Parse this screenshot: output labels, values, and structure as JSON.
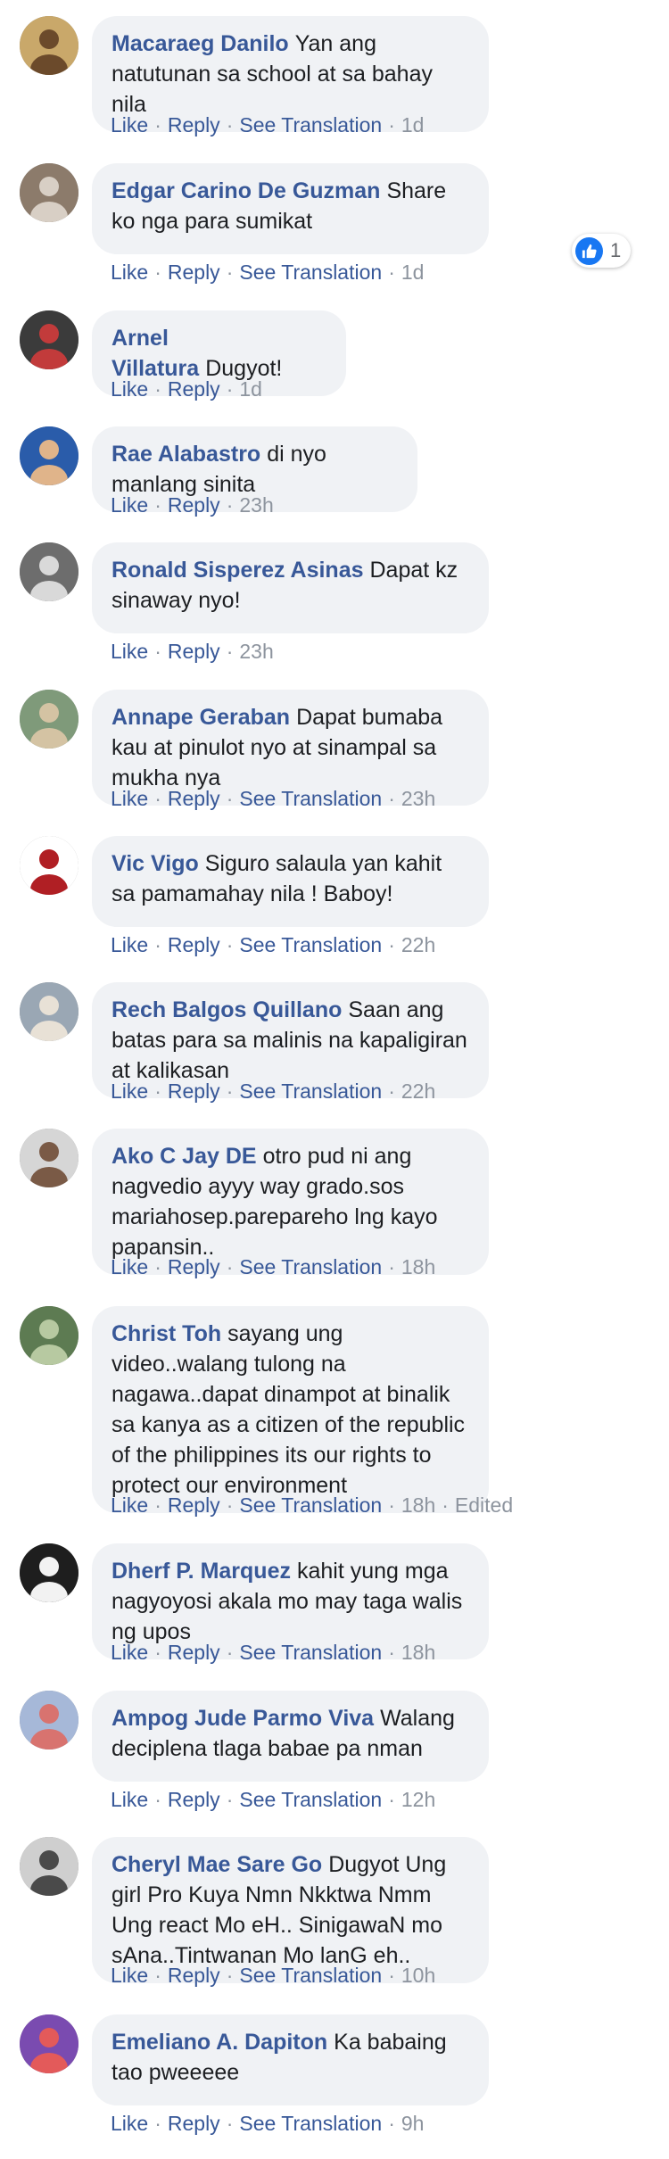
{
  "actions": {
    "like": "Like",
    "reply": "Reply",
    "see_translation": "See Translation",
    "separator": "·",
    "edited": "Edited"
  },
  "colors": {
    "author": "#385898",
    "bubble": "#f0f2f5",
    "meta": "#8d949e",
    "like_blue": "#1877f2"
  },
  "comments": [
    {
      "author": "Macaraeg Danilo",
      "text": "Yan ang natutunan sa school at sa bahay nila",
      "translation": true,
      "time": "1d"
    },
    {
      "author": "Edgar Carino De Guzman",
      "text": "Share ko nga para sumikat",
      "translation": true,
      "time": "1d",
      "reactions": {
        "icon": "thumbs-up-icon",
        "count": "1"
      }
    },
    {
      "author": "Arnel Villatura",
      "text": "Dugyot!",
      "translation": false,
      "time": "1d"
    },
    {
      "author": "Rae Alabastro",
      "text": "di nyo manlang sinita",
      "translation": false,
      "time": "23h"
    },
    {
      "author": "Ronald Sisperez Asinas",
      "text": "Dapat kz sinaway nyo!",
      "translation": false,
      "time": "23h"
    },
    {
      "author": "Annape Geraban",
      "text": "Dapat bumaba kau at pinulot nyo at sinampal sa mukha nya",
      "translation": true,
      "time": "23h"
    },
    {
      "author": "Vic Vigo",
      "text": "Siguro salaula yan kahit sa pamamahay nila ! Baboy!",
      "translation": true,
      "time": "22h"
    },
    {
      "author": "Rech Balgos Quillano",
      "text": "Saan ang batas para sa malinis na kapaligiran at kalikasan",
      "translation": true,
      "time": "22h"
    },
    {
      "author": "Ako C Jay DE",
      "text": "otro pud ni ang nagvedio ayyy way grado.sos mariahosep.parepareho lng kayo papansin..",
      "translation": true,
      "time": "18h"
    },
    {
      "author": "Christ Toh",
      "text": "sayang ung video..walang tulong na nagawa..dapat dinampot at binalik sa kanya as a citizen of the republic of the philippines its our rights to protect our environment",
      "translation": true,
      "time": "18h",
      "edited": true
    },
    {
      "author": "Dherf P. Marquez",
      "text": "kahit yung mga nagyoyosi akala mo may taga walis ng upos",
      "translation": true,
      "time": "18h"
    },
    {
      "author": "Ampog Jude Parmo Viva",
      "text": "Walang deciplena tlaga babae pa nman",
      "translation": true,
      "time": "12h"
    },
    {
      "author": "Cheryl Mae Sare Go",
      "text": "Dugyot Ung girl Pro Kuya Nmn Nkktwa Nmm Ung react Mo eH.. SinigawaN mo sAna..Tintwanan Mo lanG eh..",
      "translation": true,
      "time": "10h"
    },
    {
      "author": "Emeliano A. Dapiton",
      "text": "Ka babaing tao pweeeee",
      "translation": true,
      "time": "9h"
    }
  ]
}
